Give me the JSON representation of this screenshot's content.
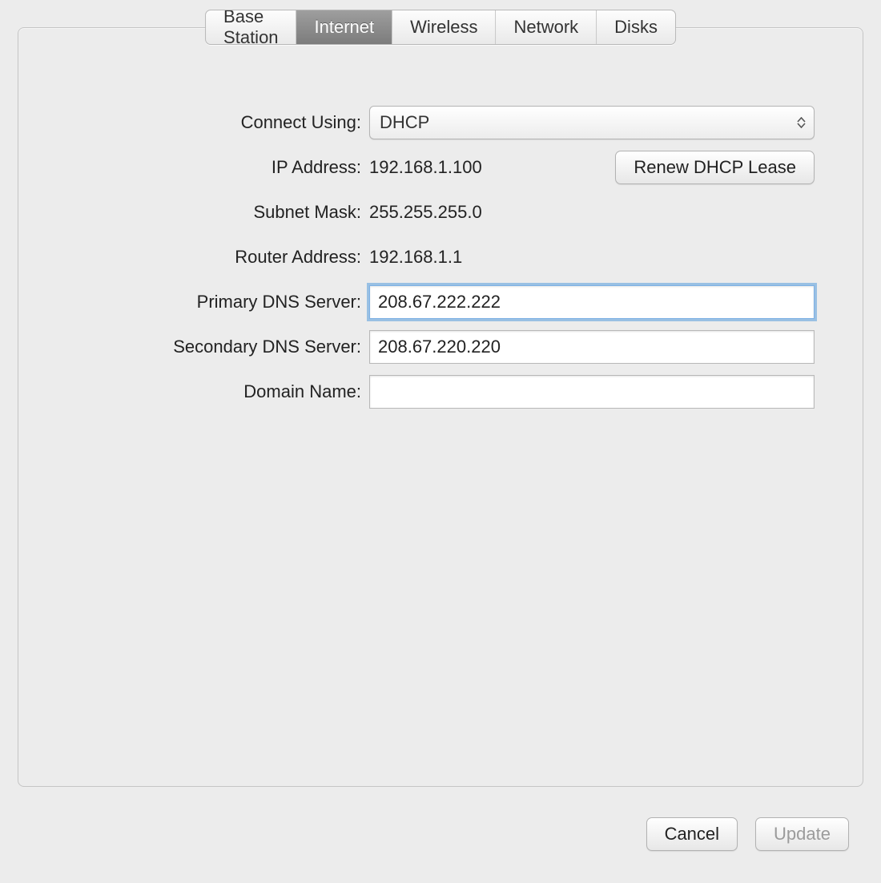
{
  "tabs": {
    "base_station": "Base Station",
    "internet": "Internet",
    "wireless": "Wireless",
    "network": "Network",
    "disks": "Disks"
  },
  "form": {
    "connect_using": {
      "label": "Connect Using:",
      "value": "DHCP"
    },
    "ip_address": {
      "label": "IP Address:",
      "value": "192.168.1.100"
    },
    "renew_btn": "Renew DHCP Lease",
    "subnet": {
      "label": "Subnet Mask:",
      "value": "255.255.255.0"
    },
    "router": {
      "label": "Router Address:",
      "value": "192.168.1.1"
    },
    "dns1": {
      "label": "Primary DNS Server:",
      "value": "208.67.222.222"
    },
    "dns2": {
      "label": "Secondary DNS Server:",
      "value": "208.67.220.220"
    },
    "domain": {
      "label": "Domain Name:",
      "value": ""
    }
  },
  "buttons": {
    "cancel": "Cancel",
    "update": "Update"
  }
}
